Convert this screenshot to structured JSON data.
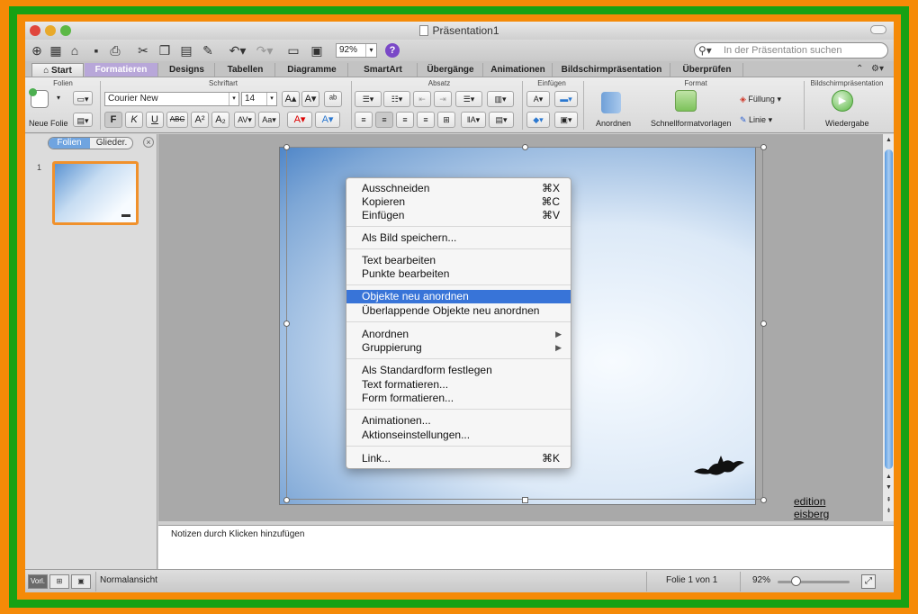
{
  "window": {
    "title": "Präsentation1"
  },
  "toolbar": {
    "zoom": "92%",
    "help": "?",
    "search_placeholder": "In der Präsentation suchen"
  },
  "tabs": [
    "Start",
    "Formatieren",
    "Designs",
    "Tabellen",
    "Diagramme",
    "SmartArt",
    "Übergänge",
    "Animationen",
    "Bildschirmpräsentation",
    "Überprüfen"
  ],
  "ribbon": {
    "groups": {
      "folien": "Folien",
      "schriftart": "Schriftart",
      "absatz": "Absatz",
      "einfuegen": "Einfügen",
      "format": "Format",
      "bildschirm": "Bildschirmpräsentation"
    },
    "new_slide": "Neue Folie",
    "font": "Courier New",
    "size": "14",
    "bold": "F",
    "italic": "K",
    "underline": "U",
    "strike": "ABC",
    "arrange": "Anordnen",
    "quick_styles": "Schnellformatvorlagen",
    "fill": "Füllung",
    "line": "Linie",
    "play": "Wiedergabe"
  },
  "sidebar": {
    "tab_slides": "Folien",
    "tab_outline": "Glieder.",
    "slide_number": "1"
  },
  "slide": {
    "brand": "edition eisberg"
  },
  "context_menu": [
    {
      "label": "Ausschneiden",
      "shortcut": "⌘X"
    },
    {
      "label": "Kopieren",
      "shortcut": "⌘C"
    },
    {
      "label": "Einfügen",
      "shortcut": "⌘V"
    },
    {
      "label": "Als Bild speichern..."
    },
    {
      "label": "Text bearbeiten"
    },
    {
      "label": "Punkte bearbeiten"
    },
    {
      "label": "Objekte neu anordnen",
      "highlighted": true
    },
    {
      "label": "Überlappende Objekte neu anordnen"
    },
    {
      "label": "Anordnen"
    },
    {
      "label": "Gruppierung"
    },
    {
      "label": "Als Standardform festlegen"
    },
    {
      "label": "Text formatieren..."
    },
    {
      "label": "Form formatieren..."
    },
    {
      "label": "Animationen..."
    },
    {
      "label": "Aktionseinstellungen..."
    },
    {
      "label": "Link...",
      "shortcut": "⌘K"
    }
  ],
  "notes": {
    "placeholder": "Notizen durch Klicken hinzufügen"
  },
  "status": {
    "view": "Normalansicht",
    "slide_of": "Folie 1 von 1",
    "zoom": "92%",
    "view_button": "Vorl."
  },
  "colors": {
    "accent_tab": "#b8a7d9",
    "highlight": "#3874d8",
    "thumb_border": "#f0912c",
    "frame_outer": "#f58a07",
    "frame_inner": "#18a114"
  }
}
